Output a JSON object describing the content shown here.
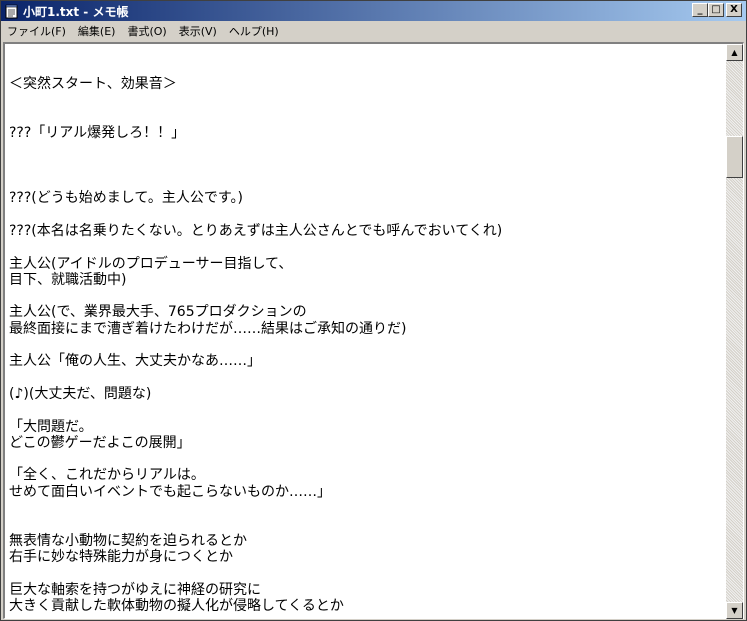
{
  "window": {
    "title": "小町1.txt - メモ帳",
    "buttons": {
      "minimize": "_",
      "maximize": "□",
      "close": "X"
    }
  },
  "menu": [
    "ファイル(F)",
    "編集(E)",
    "書式(O)",
    "表示(V)",
    "ヘルプ(H)"
  ],
  "content": {
    "lines": [
      "",
      "＜突然スタート、効果音＞",
      "",
      "",
      "???「リアル爆発しろ！！」",
      "",
      "",
      "",
      "???(どうも始めまして。主人公です。)",
      "",
      "???(本名は名乗りたくない。とりあえずは主人公さんとでも呼んでおいてくれ)",
      "",
      "主人公(アイドルのプロデューサー目指して、",
      "目下、就職活動中)",
      "",
      "主人公(で、業界最大手、765プロダクションの",
      "最終面接にまで漕ぎ着けたわけだが……結果はご承知の通りだ)",
      "",
      "主人公「俺の人生、大丈夫かなあ……」",
      "",
      "(♪)(大丈夫だ、問題な)",
      "",
      "「大問題だ。",
      "どこの鬱ゲーだよこの展開」",
      "",
      "「全く、これだからリアルは。",
      "せめて面白いイベントでも起こらないものか……」",
      "",
      "",
      "無表情な小動物に契約を迫られるとか",
      "右手に妙な特殊能力が身につくとか",
      "",
      "巨大な軸索を持つがゆえに神経の研究に",
      "大きく貢献した軟体動物の擬人化が侵略してくるとか"
    ]
  },
  "scrollbar": {
    "up_arrow": "▲",
    "down_arrow": "▼",
    "position": 0.15
  }
}
